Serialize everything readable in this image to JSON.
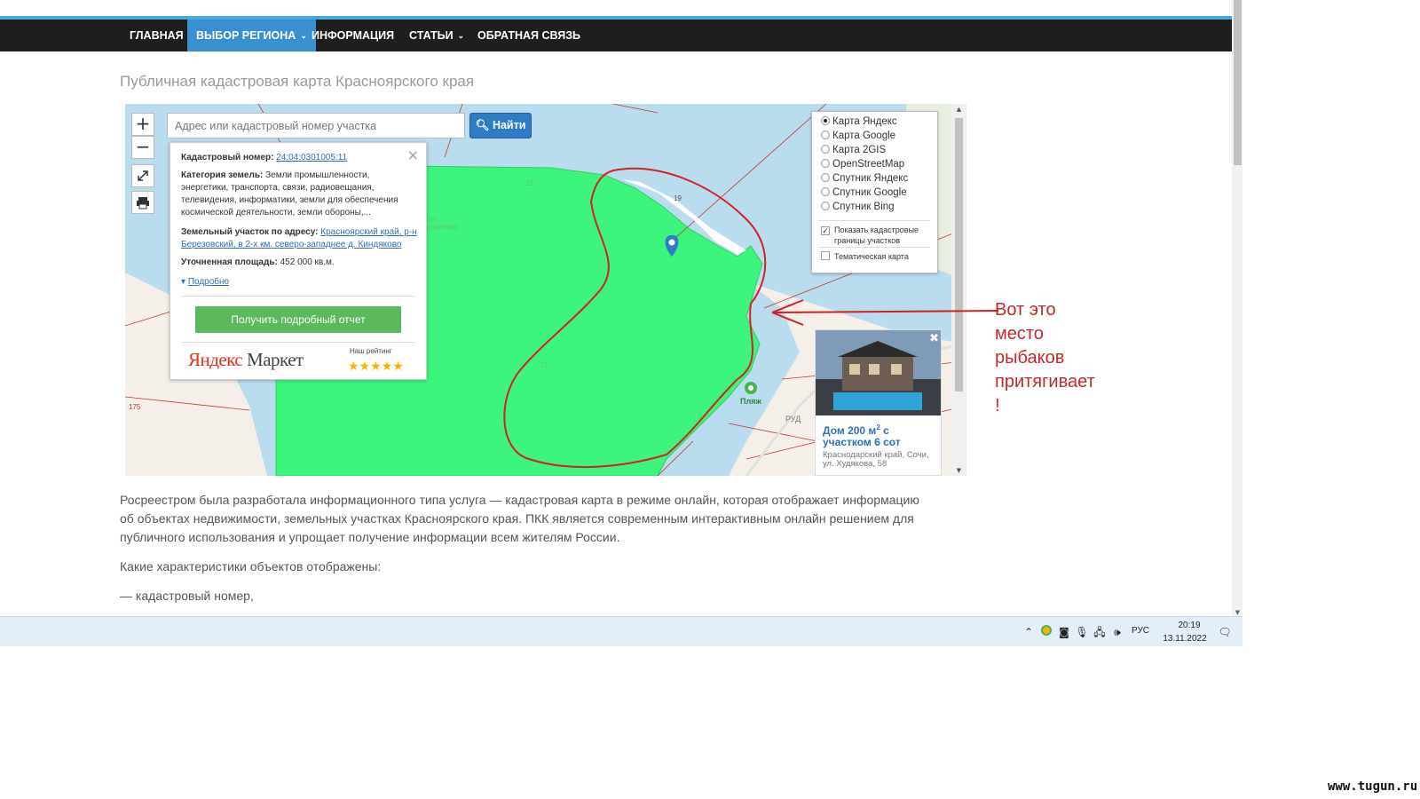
{
  "nav": {
    "items": [
      {
        "label": "ГЛАВНАЯ"
      },
      {
        "label": "ВЫБОР РЕГИОНА",
        "caret": "⌄"
      },
      {
        "label": "ИНФОРМАЦИЯ"
      },
      {
        "label": "СТАТЬИ",
        "caret": "⌄"
      },
      {
        "label": "ОБРАТНАЯ СВЯЗЬ"
      }
    ],
    "active_color": "#3a8fd0"
  },
  "page_title": "Публичная кадастровая карта Красноярского края",
  "map": {
    "zoom_in": "+",
    "zoom_out": "−",
    "search_placeholder": "Адрес или кадастровый номер участка",
    "search_button": "Найти",
    "labels": {
      "l11a": "11",
      "l11b": "11",
      "l19": "19",
      "l175": "175",
      "village": "оз.\nохватово",
      "beach": "Пляж",
      "rud": "РУД"
    },
    "parcel_color": "#3df57d",
    "info": {
      "cad_label": "Кадастровый номер:",
      "cad_value": "24:04:0301005:11",
      "cat_label": "Категория земель:",
      "cat_value": "Земли промышленности, энергетики, транспорта, связи, радиовещания, телевидения, информатики, земли для обеспечения космической деятельности, земли обороны,...",
      "addr_label": "Земельный участок по адресу:",
      "addr_value": "Красноярский край, р-н Березовский, в 2-х км. северо-западнее д. Киндяково",
      "area_label": "Уточненная площадь:",
      "area_value": "452 000 кв.м.",
      "more": "Подробно",
      "report_button": "Получить подробный отчет",
      "market_brand": "Яндекс",
      "market_word": "Маркет",
      "rating_label": "Наш рейтинг",
      "stars": "★★★★★"
    },
    "layers": {
      "options": [
        {
          "label": "Карта Яндекс",
          "selected": true
        },
        {
          "label": "Карта Google",
          "selected": false
        },
        {
          "label": "Карта 2GIS",
          "selected": false
        },
        {
          "label": "OpenStreetMap",
          "selected": false
        },
        {
          "label": "Спутник Яндекс",
          "selected": false
        },
        {
          "label": "Спутник Google",
          "selected": false
        },
        {
          "label": "Спутник Bing",
          "selected": false
        }
      ],
      "show_borders": "Показать кадастровые границы участков",
      "show_borders_checked": true,
      "thematic": "Тематическая карта",
      "thematic_checked": false
    },
    "ad": {
      "close": "✖",
      "title_main": "Дом 200 м",
      "title_sup": "2",
      "title_rest": " с участком 6 сот",
      "address": "Краснодарский край, Сочи, ул. Худякова, 58"
    }
  },
  "annotation": "Вот это\nместо\nрыбаков\nпритягивает\n!",
  "article": {
    "p1": "Росреестром была разработала информационного типа услуга — кадастровая карта в режиме онлайн, которая отображает информацию об объектах недвижимости, земельных участках Красноярского края. ПКК является современным интерактивным онлайн решением для публичного использования и упрощает получение информации всем жителям России.",
    "p2": "Какие характеристики объектов отображены:",
    "p3": "— кадастровый номер,"
  },
  "taskbar": {
    "lang": "РУС",
    "time": "20:19",
    "date": "13.11.2022"
  },
  "watermark": "www.tugun.ru"
}
